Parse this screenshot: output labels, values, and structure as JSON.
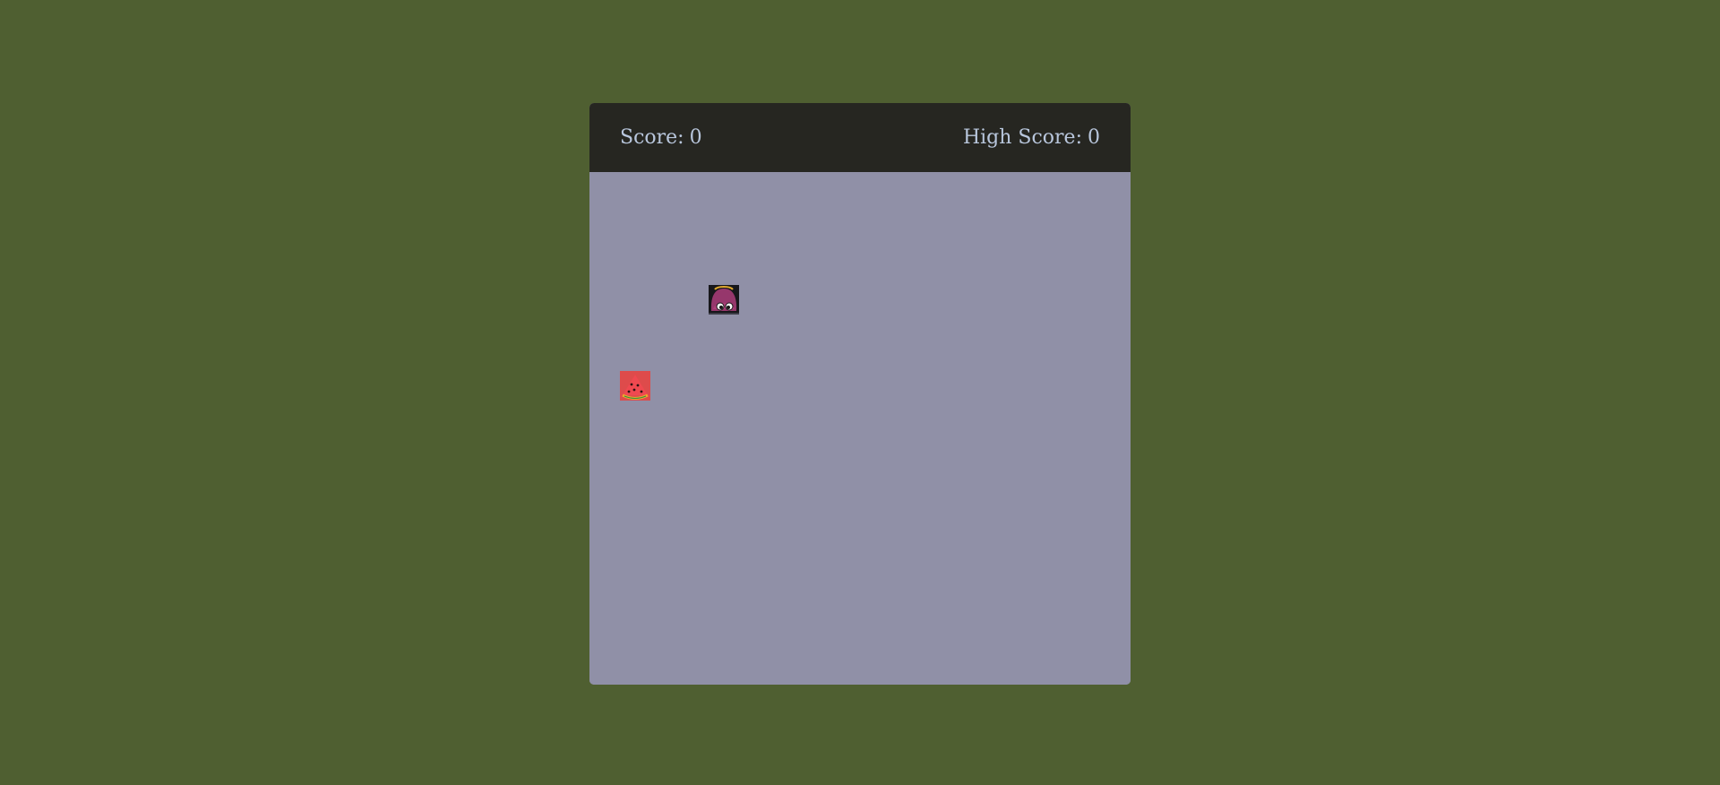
{
  "game": {
    "score_label": "Score:",
    "score_value": "0",
    "high_score_label": "High Score:",
    "high_score_value": "0"
  },
  "board": {
    "snake_head_icon": "octopus-snake-head-icon",
    "food_icon": "watermelon-slice-icon"
  },
  "colors": {
    "page_background": "#4f5f31",
    "header_background": "#262621",
    "board_background": "#9090a7",
    "header_text": "#b8c6dc"
  }
}
